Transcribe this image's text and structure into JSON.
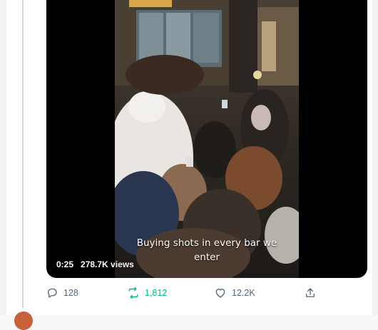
{
  "video": {
    "caption_line1": "Buying shots in every bar we",
    "caption_line2": "enter",
    "timestamp": "0:25",
    "views": "278.7K views"
  },
  "actions": {
    "reply_count": "128",
    "repost_count": "1,812",
    "like_count": "12.2K"
  },
  "colors": {
    "repost_active": "#00ba7c",
    "icon_gray": "#536471",
    "thread_line": "#cfd9de"
  },
  "icons": [
    "reply-icon",
    "repost-icon",
    "like-icon",
    "share-icon"
  ]
}
